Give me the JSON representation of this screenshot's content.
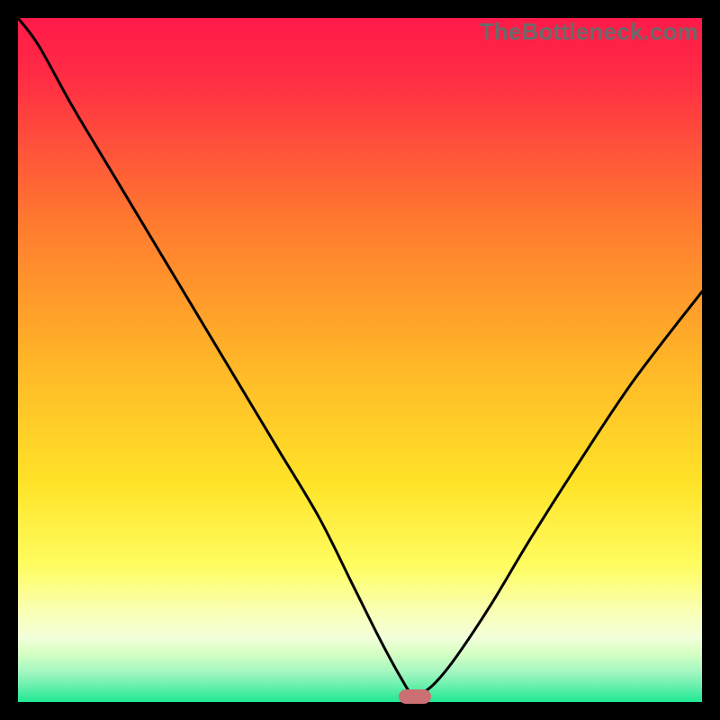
{
  "watermark": "TheBottleneck.com",
  "colors": {
    "background_top": "#ff1a49",
    "background_mid1": "#ff8a2a",
    "background_mid2": "#ffe328",
    "background_low": "#f9ffb7",
    "background_band": "#d5ffc4",
    "background_bottom": "#1fe893",
    "curve": "#000000",
    "marker": "#cc6f73",
    "frame": "#000000"
  },
  "chart_data": {
    "type": "line",
    "title": "",
    "xlabel": "",
    "ylabel": "",
    "xlim": [
      0,
      100
    ],
    "ylim": [
      0,
      100
    ],
    "grid": false,
    "legend": false,
    "series": [
      {
        "name": "bottleneck-curve",
        "x": [
          0,
          3,
          8,
          14,
          20,
          26,
          32,
          38,
          44,
          49,
          53,
          56,
          57.5,
          59,
          61,
          64,
          69,
          75,
          82,
          90,
          100
        ],
        "y": [
          100,
          96,
          87,
          77,
          67,
          57,
          47,
          37,
          27,
          17,
          9,
          3.5,
          1.3,
          1.3,
          2.8,
          6.5,
          14,
          24,
          35,
          47,
          60
        ]
      }
    ],
    "annotations": [
      {
        "name": "bottleneck-marker",
        "shape": "pill",
        "x": 58,
        "y": 0.8,
        "color": "#cc6f73"
      }
    ],
    "gradient_stops": [
      {
        "offset": 0.0,
        "color": "#ff1a49"
      },
      {
        "offset": 0.08,
        "color": "#ff2a45"
      },
      {
        "offset": 0.3,
        "color": "#ff7a2f"
      },
      {
        "offset": 0.5,
        "color": "#ffb528"
      },
      {
        "offset": 0.68,
        "color": "#ffe328"
      },
      {
        "offset": 0.8,
        "color": "#fffd60"
      },
      {
        "offset": 0.87,
        "color": "#f9ffb7"
      },
      {
        "offset": 0.905,
        "color": "#f3ffda"
      },
      {
        "offset": 0.93,
        "color": "#d5ffc4"
      },
      {
        "offset": 0.955,
        "color": "#a6f7c2"
      },
      {
        "offset": 0.975,
        "color": "#6df0ae"
      },
      {
        "offset": 1.0,
        "color": "#1fe893"
      }
    ]
  }
}
